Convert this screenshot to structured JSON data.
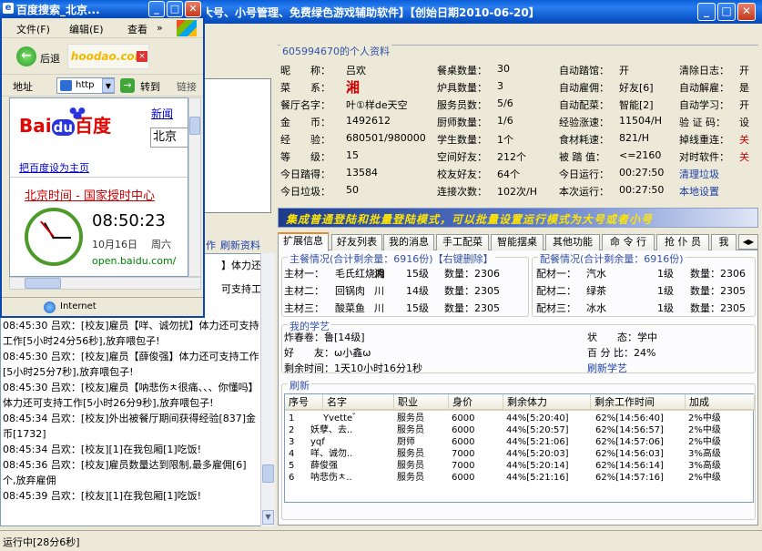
{
  "app": {
    "title": "大号、小号管理、免费绿色游戏辅助软件】【创始日期2010-06-20】",
    "status": "运行中[28分6秒]"
  },
  "left": {
    "toolbar_items": [
      "作",
      "刷新资料"
    ]
  },
  "log": [
    "】体力还",
    "可支持工",
    "08:45:30 吕欢：[校友]雇员【咩、诚勿扰】体力还可支持工作[5小时24分56秒],放弃喂包子!",
    "08:45:30 吕欢：[校友]雇员【薛俊强】体力还可支持工作[5小时25分7秒],放弃喂包子!",
    "08:45:30 吕欢：[校友]雇员【呐悲伤ㅊ很痛、、、你懂吗】体力还可支持工作[5小时26分9秒],放弃喂包子!",
    "08:45:34 吕欢：[校友]外出被餐厅期间获得经验[837]金币[1732]",
    "08:45:34 吕欢：[校友][1]在我包厢[1]吃饭!",
    "08:45:36 吕欢：[校友]雇员数量达到限制,最多雇佣[6]个,放弃雇佣",
    "08:45:39 吕欢：[校友][1]在我包厢[1]吃饭!"
  ],
  "info": {
    "header": "605994670的个人资料",
    "rows": [
      [
        [
          "昵　　称：",
          "吕欢"
        ],
        [
          "餐桌数量：",
          "30"
        ],
        [
          "自动踏馆：",
          "开"
        ],
        [
          "清除日志：",
          "开"
        ]
      ],
      [
        [
          "菜　　系：",
          "湘"
        ],
        [
          "炉具数量：",
          "3"
        ],
        [
          "自动雇佣：",
          "好友[6]"
        ],
        [
          "自动解雇：",
          "是"
        ]
      ],
      [
        [
          "餐厅名字：",
          "叶①样de天空"
        ],
        [
          "服务员数：",
          "5/6"
        ],
        [
          "自动配菜：",
          "智能[2]"
        ],
        [
          "自动学习：",
          "开"
        ]
      ],
      [
        [
          "金　　币：",
          "1492612"
        ],
        [
          "厨师数量：",
          "1/6"
        ],
        [
          "经验涨速：",
          "11504/H"
        ],
        [
          "验 证 码：",
          "设"
        ]
      ],
      [
        [
          "经　　验：",
          "680501/980000"
        ],
        [
          "学生数量：",
          "1个"
        ],
        [
          "食材耗速：",
          "821/H"
        ],
        [
          "掉线重连：",
          "关"
        ]
      ],
      [
        [
          "等　　级：",
          "15"
        ],
        [
          "空间好友：",
          "212个"
        ],
        [
          "被 踏 值：",
          "<=2160"
        ],
        [
          "对时软件：",
          "关"
        ]
      ],
      [
        [
          "今日踏得：",
          "13584"
        ],
        [
          "校友好友：",
          "64个"
        ],
        [
          "今日运行：",
          "00:27:50"
        ],
        [
          "清理垃圾",
          ""
        ]
      ],
      [
        [
          "今日垃圾：",
          "50"
        ],
        [
          "连接次数：",
          "102次/H"
        ],
        [
          "本次运行：",
          "00:27:50"
        ],
        [
          "本地设置",
          ""
        ]
      ]
    ]
  },
  "banner": "集成普通登陆和批量登陆模式，可以批量设置运行模式为大号或者小号",
  "tabs": [
    "扩展信息",
    "好友列表",
    "我的消息",
    "手工配菜",
    "智能摆桌",
    "其他功能",
    "命 令 行",
    "抢 仆 员",
    "我"
  ],
  "main_mats": {
    "title": "主餐情况(合计剩余量：6916份)【右键删除】",
    "rows": [
      [
        "主材一：",
        "毛氏红烧肉",
        "湘",
        "15级",
        "数量：2306"
      ],
      [
        "主材二：",
        "回锅肉",
        "川",
        "14级",
        "数量：2305"
      ],
      [
        "主材三：",
        "酸菜鱼",
        "川",
        "15级",
        "数量：2305"
      ]
    ]
  },
  "side_mats": {
    "title": "配餐情况(合计剩余量：6916份)",
    "rows": [
      [
        "配材一：",
        "汽水",
        "1级",
        "数量：2306"
      ],
      [
        "配材二：",
        "绿茶",
        "1级",
        "数量：2305"
      ],
      [
        "配材三：",
        "冰水",
        "1级",
        "数量：2305"
      ]
    ]
  },
  "study": {
    "title": "我的学艺",
    "lines": [
      [
        "炸春卷：鲁[14级]",
        "状　　态：学中"
      ],
      [
        "好　　友：ω小鑫ω",
        "百 分 比：24%"
      ],
      [
        "剩余时间：1天10小时16分1秒",
        "刷新学艺"
      ]
    ]
  },
  "refresh_title": "刷新",
  "table": {
    "headers": [
      "序号",
      "名字",
      "职业",
      "身价",
      "剩余体力",
      "剩余工作时间",
      "加成"
    ],
    "rows": [
      [
        "1",
        "Yvette゛",
        "服务员",
        "6000",
        "44%[5:20:40]",
        "62%[14:56:40]",
        "2%中级"
      ],
      [
        "2",
        "妖孽、去..",
        "服务员",
        "6000",
        "44%[5:20:57]",
        "62%[14:56:57]",
        "2%中级"
      ],
      [
        "3",
        "yqf",
        "厨师",
        "6000",
        "44%[5:21:06]",
        "62%[14:57:06]",
        "2%中级"
      ],
      [
        "4",
        "咩、诚勿..",
        "服务员",
        "7000",
        "44%[5:20:03]",
        "62%[14:56:03]",
        "3%高级"
      ],
      [
        "5",
        "薛俊强",
        "服务员",
        "7000",
        "44%[5:20:14]",
        "62%[14:56:14]",
        "3%高级"
      ],
      [
        "6",
        "呐悲伤ㅊ..",
        "服务员",
        "6000",
        "44%[5:21:16]",
        "62%[14:57:16]",
        "2%中级"
      ]
    ]
  },
  "ie": {
    "title": "百度搜索_北京...",
    "menu": [
      "文件(F)",
      "编辑(E)",
      "查看",
      "»"
    ],
    "watermark": "hoodao.com",
    "back_label": "后退",
    "addr_label": "地址",
    "addr_value": "http",
    "go_label": "转到",
    "links_label": "链接",
    "baidu_news": "新闻",
    "search_value": "北京",
    "set_home": "把百度设为主页",
    "result_title": "北京时间 - 国家授时中心",
    "clock_time": "08:50:23",
    "clock_date": "10月16日",
    "clock_weekday": "周六",
    "result_url": "open.baidu.com/",
    "status_zone": "Internet"
  },
  "colors": {
    "titlebar": "#0a5fd8",
    "accent_blue": "#3451a5",
    "alert_red": "#d00000",
    "banner_yellow": "#ffe600"
  }
}
